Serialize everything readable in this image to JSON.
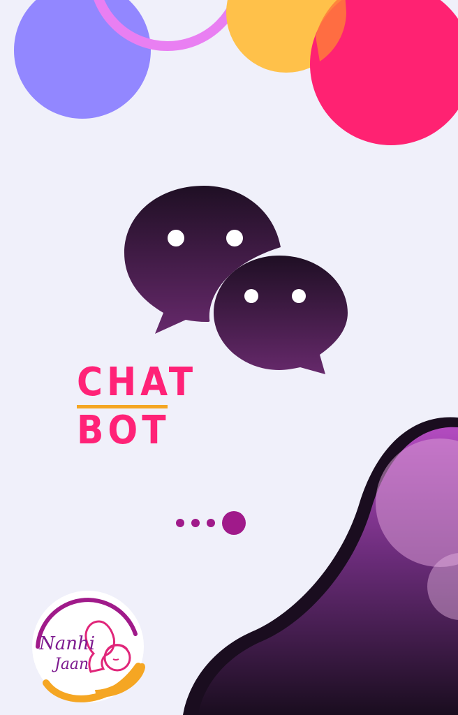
{
  "title": {
    "line1": "CHAT",
    "line2": "BOT"
  },
  "pager": {
    "total": 4,
    "active_index": 3
  },
  "logo": {
    "text": "Nanhi Jaan"
  },
  "colors": {
    "background": "#f0f0fa",
    "title": "#ff2277",
    "underline": "#f5a623",
    "dots": "#a01a8a",
    "bubble_top": "#1f0f24",
    "bubble_bottom": "#66296b"
  },
  "icons": [
    "chat-bubbles-icon"
  ]
}
